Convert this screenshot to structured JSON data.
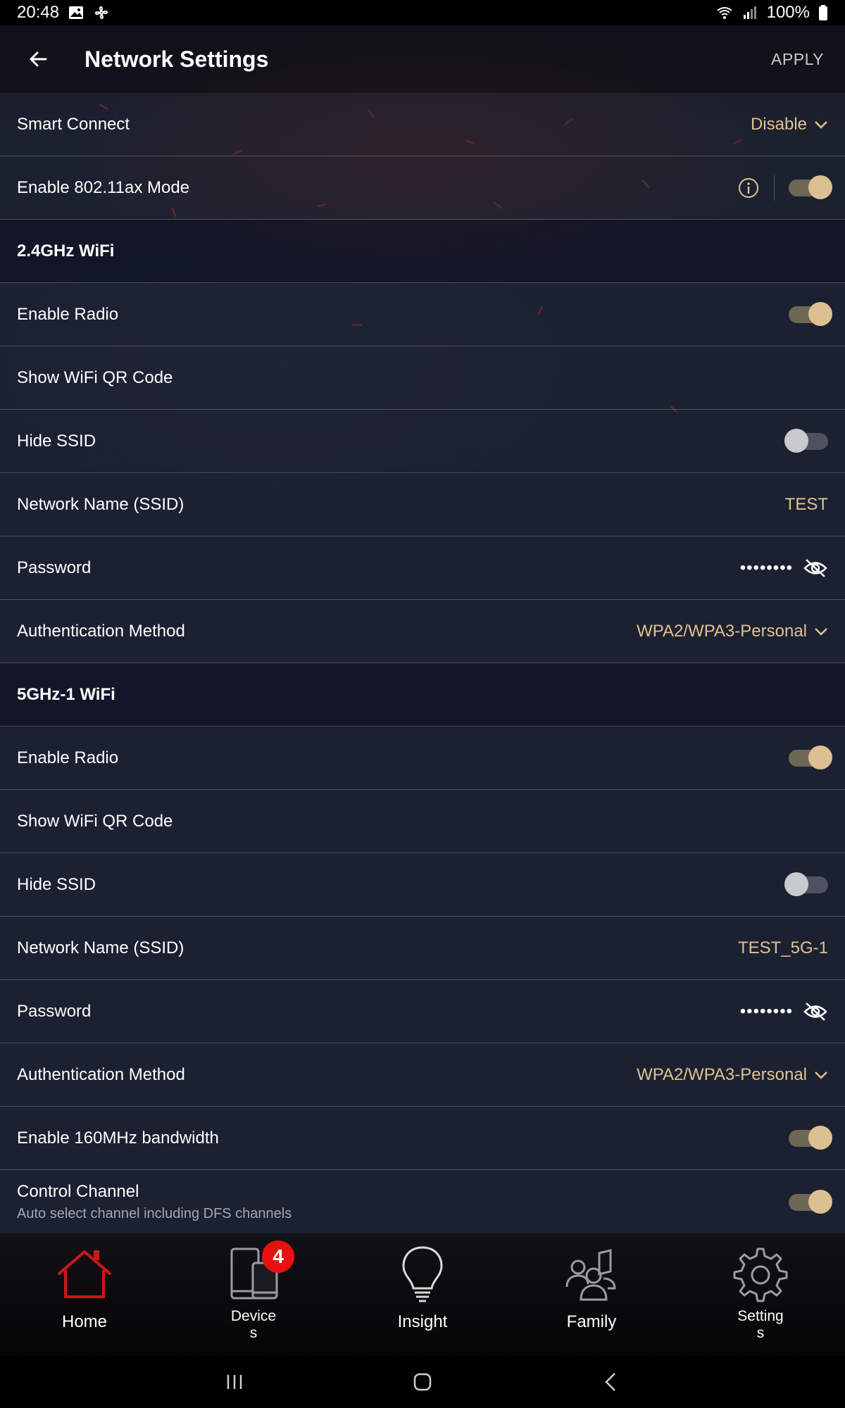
{
  "status_bar": {
    "time": "20:48",
    "battery": "100%"
  },
  "header": {
    "title": "Network Settings",
    "apply_label": "APPLY"
  },
  "general": {
    "smart_connect": {
      "label": "Smart Connect",
      "value": "Disable"
    },
    "ax_mode": {
      "label": "Enable 802.11ax Mode",
      "enabled": true
    }
  },
  "band_24": {
    "title": "2.4GHz WiFi",
    "enable_radio": {
      "label": "Enable Radio",
      "enabled": true
    },
    "show_qr": {
      "label": "Show WiFi QR Code"
    },
    "hide_ssid": {
      "label": "Hide SSID",
      "enabled": false
    },
    "ssid": {
      "label": "Network Name (SSID)",
      "value": "TEST"
    },
    "password": {
      "label": "Password",
      "masked": "••••••••"
    },
    "auth": {
      "label": "Authentication Method",
      "value": "WPA2/WPA3-Personal"
    }
  },
  "band_5g1": {
    "title": "5GHz-1 WiFi",
    "enable_radio": {
      "label": "Enable Radio",
      "enabled": true
    },
    "show_qr": {
      "label": "Show WiFi QR Code"
    },
    "hide_ssid": {
      "label": "Hide SSID",
      "enabled": false
    },
    "ssid": {
      "label": "Network Name (SSID)",
      "value": "TEST_5G-1"
    },
    "password": {
      "label": "Password",
      "masked": "••••••••"
    },
    "auth": {
      "label": "Authentication Method",
      "value": "WPA2/WPA3-Personal"
    },
    "bw160": {
      "label": "Enable 160MHz bandwidth",
      "enabled": true
    },
    "control_channel": {
      "label": "Control Channel",
      "sublabel": "Auto select channel including DFS channels",
      "enabled": true
    }
  },
  "bottom_nav": {
    "items": [
      {
        "label": "Home",
        "icon": "home-icon",
        "active": true
      },
      {
        "label_line1": "Device",
        "label_line2": "s",
        "icon": "devices-icon",
        "badge": "4"
      },
      {
        "label": "Insight",
        "icon": "lightbulb-icon"
      },
      {
        "label": "Family",
        "icon": "family-icon"
      },
      {
        "label_line1": "Setting",
        "label_line2": "s",
        "icon": "gear-icon"
      }
    ]
  },
  "colors": {
    "accent_gold": "#e0c28e",
    "active_red": "#d0161b",
    "badge_red": "#e81010"
  }
}
